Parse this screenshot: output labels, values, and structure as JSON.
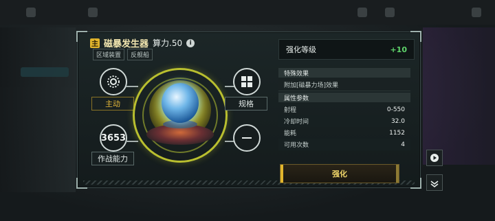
{
  "item": {
    "rank_badge": "主",
    "name": "磁暴发生器",
    "power": "算力.50",
    "info_glyph": "i",
    "tags": [
      "区域装置",
      "反舰船"
    ]
  },
  "left_stats": {
    "type_label": "主动",
    "combat_value": "3653",
    "combat_label": "作战能力"
  },
  "right_stats": {
    "spec_label": "规格"
  },
  "side": {
    "enhance_level_label": "强化等级",
    "enhance_level_value": "+10",
    "special_effect_label": "特殊效果",
    "special_effect_text": "附加[磁暴力场]效果",
    "attributes_label": "属性参数",
    "attributes": [
      {
        "name": "射程",
        "value": "0-550"
      },
      {
        "name": "冷却时间",
        "value": "32.0"
      },
      {
        "name": "能耗",
        "value": "1152"
      },
      {
        "name": "可用次数",
        "value": "4"
      }
    ],
    "enhance_button": "强化"
  },
  "colors": {
    "accent_gold": "#e2b52c",
    "accent_green": "#5fd46b",
    "ring_yellow": "#b9bf2f"
  },
  "icons": [
    "gear-icon",
    "grid-icon",
    "minus-icon",
    "play-icon",
    "collapse-icon",
    "info-icon"
  ]
}
